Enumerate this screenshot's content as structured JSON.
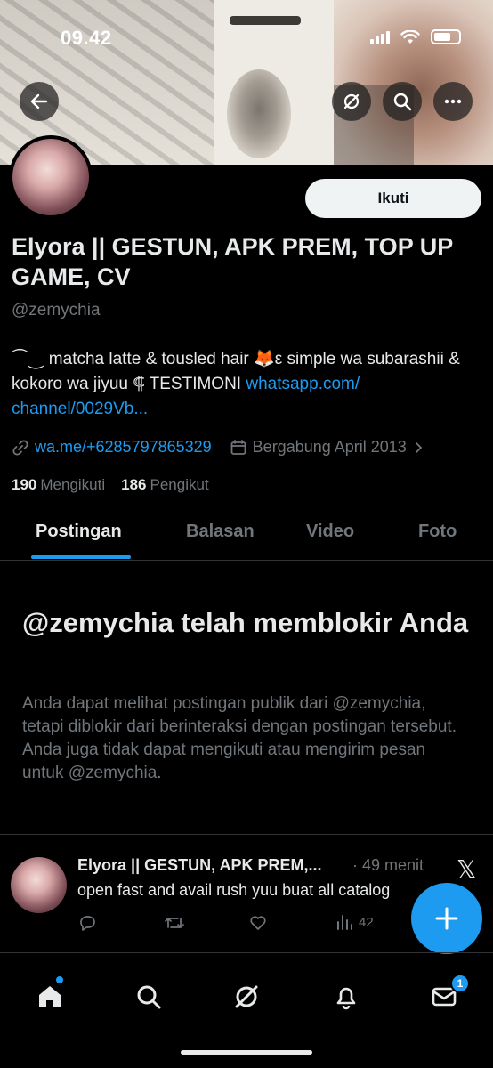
{
  "status_bar": {
    "time": "09.42"
  },
  "profile": {
    "follow_label": "Ikuti",
    "display_name": "Elyora || GESTUN, APK PREM, TOP UP GAME, CV",
    "handle": "@zemychia",
    "bio_text": "⏜⏝ matcha latte & tousled hair 🦊ε simple wa subarashii & kokoro wa jiyuu ⸿ TESTIMONI ",
    "bio_link": "whatsapp.com/ channel/0029Vb...",
    "website": "wa.me/+6285797865329",
    "joined": "Bergabung April 2013",
    "following_count": "190",
    "following_label": "Mengikuti",
    "followers_count": "186",
    "followers_label": "Pengikut"
  },
  "tabs": [
    {
      "label": "Postingan",
      "active": true
    },
    {
      "label": "Balasan",
      "active": false
    },
    {
      "label": "Video",
      "active": false
    },
    {
      "label": "Foto",
      "active": false
    }
  ],
  "blocked": {
    "title": "@zemychia telah memblokir Anda",
    "message": "Anda dapat melihat postingan publik dari @zemychia, tetapi diblokir dari berinteraksi dengan postingan tersebut. Anda juga tidak dapat mengikuti atau mengirim pesan untuk @zemychia."
  },
  "post": {
    "author": "Elyora || GESTUN, APK PREM,...",
    "time": "· 49 menit",
    "text": "open fast and avail rush yuu buat all catalog",
    "views": "42"
  },
  "bottom_nav": {
    "messages_badge": "1"
  },
  "colors": {
    "accent": "#1d9bf0",
    "background": "#000000",
    "secondary_text": "#71767b"
  },
  "icons": [
    "back-arrow-icon",
    "grok-icon",
    "search-icon",
    "more-icon",
    "link-icon",
    "calendar-icon",
    "chevron-right-icon",
    "reply-icon",
    "repost-icon",
    "like-icon",
    "views-icon",
    "compose-plus-icon",
    "home-icon",
    "search-icon",
    "grok-icon",
    "notifications-icon",
    "messages-icon",
    "x-logo-icon"
  ]
}
